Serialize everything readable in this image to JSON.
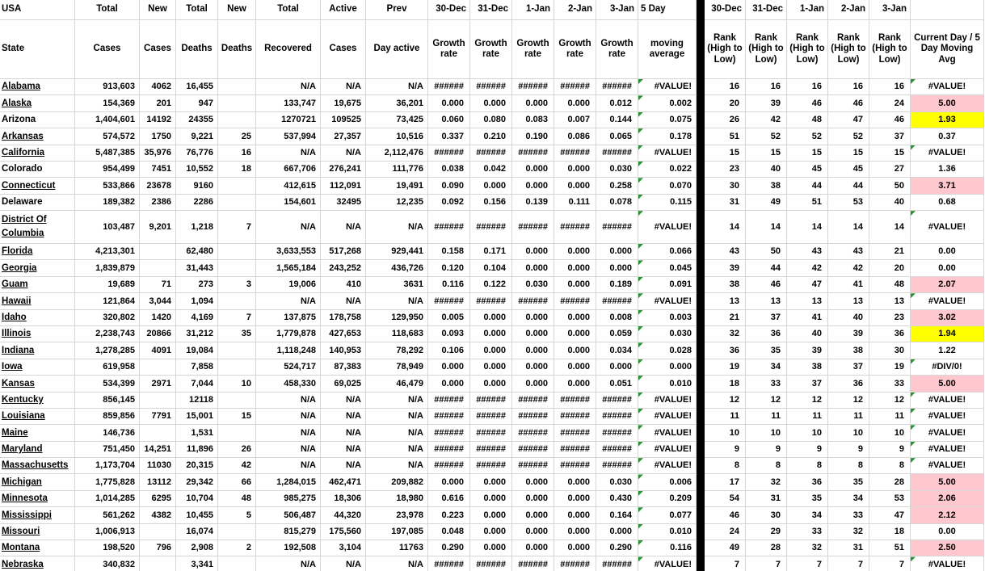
{
  "colors": {
    "gridline": "#d6d6d6",
    "highlight_pink": "#ffc7ce",
    "highlight_yellow": "#ffff00",
    "error_flag_green": "#2a9134",
    "divider_black": "#000000"
  },
  "header": {
    "row1": [
      "USA",
      "Total",
      "New",
      "Total",
      "New",
      "Total",
      "Active",
      "Prev",
      "30-Dec",
      "31-Dec",
      "1-Jan",
      "2-Jan",
      "3-Jan",
      "5 Day",
      "",
      "30-Dec",
      "31-Dec",
      "1-Jan",
      "2-Jan",
      "3-Jan",
      ""
    ],
    "row2": [
      "State",
      "Cases",
      "Cases",
      "Deaths",
      "Deaths",
      "Recovered",
      "Cases",
      "Day active",
      "Growth rate",
      "Growth rate",
      "Growth rate",
      "Growth rate",
      "Growth rate",
      "moving average",
      "",
      "Rank (High to Low)",
      "Rank (High to Low)",
      "Rank (High to Low)",
      "Rank (High to Low)",
      "Rank (High to Low)",
      "Current Day / 5 Day Moving Avg"
    ]
  },
  "rows": [
    {
      "state": "Alabama",
      "underline": true,
      "tall": false,
      "cases": "913,603",
      "new_cases": "4062",
      "deaths": "16,455",
      "new_deaths": "",
      "recovered": "N/A",
      "active": "N/A",
      "prev": "N/A",
      "g": [
        "######",
        "######",
        "######",
        "######",
        "######"
      ],
      "avg": "#VALUE!",
      "rank": [
        "16",
        "16",
        "16",
        "16",
        "16"
      ],
      "ratio": "#VALUE!",
      "ratio_bg": "none",
      "ratio_flag": true
    },
    {
      "state": "Alaska",
      "underline": true,
      "tall": false,
      "cases": "154,369",
      "new_cases": "201",
      "deaths": "947",
      "new_deaths": "",
      "recovered": "133,747",
      "active": "19,675",
      "prev": "36,201",
      "g": [
        "0.000",
        "0.000",
        "0.000",
        "0.000",
        "0.012"
      ],
      "avg": "0.002",
      "rank": [
        "20",
        "39",
        "46",
        "46",
        "24"
      ],
      "ratio": "5.00",
      "ratio_bg": "pink",
      "ratio_flag": false
    },
    {
      "state": "Arizona",
      "underline": false,
      "tall": false,
      "cases": "1,404,601",
      "new_cases": "14192",
      "deaths": "24355",
      "new_deaths": "",
      "recovered": "1270721",
      "active": "109525",
      "prev": "73,425",
      "g": [
        "0.060",
        "0.080",
        "0.083",
        "0.007",
        "0.144"
      ],
      "avg": "0.075",
      "rank": [
        "26",
        "42",
        "48",
        "47",
        "46"
      ],
      "ratio": "1.93",
      "ratio_bg": "yellow",
      "ratio_flag": false
    },
    {
      "state": "Arkansas",
      "underline": true,
      "tall": false,
      "cases": "574,572",
      "new_cases": "1750",
      "deaths": "9,221",
      "new_deaths": "25",
      "recovered": "537,994",
      "active": "27,357",
      "prev": "10,516",
      "g": [
        "0.337",
        "0.210",
        "0.190",
        "0.086",
        "0.065"
      ],
      "avg": "0.178",
      "rank": [
        "51",
        "52",
        "52",
        "52",
        "37"
      ],
      "ratio": "0.37",
      "ratio_bg": "none",
      "ratio_flag": false
    },
    {
      "state": "California",
      "underline": true,
      "tall": false,
      "cases": "5,487,385",
      "new_cases": "35,976",
      "deaths": "76,776",
      "new_deaths": "16",
      "recovered": "N/A",
      "active": "N/A",
      "prev": "2,112,476",
      "g": [
        "######",
        "######",
        "######",
        "######",
        "######"
      ],
      "avg": "#VALUE!",
      "rank": [
        "15",
        "15",
        "15",
        "15",
        "15"
      ],
      "ratio": "#VALUE!",
      "ratio_bg": "none",
      "ratio_flag": true
    },
    {
      "state": "Colorado",
      "underline": false,
      "tall": false,
      "cases": "954,499",
      "new_cases": "7451",
      "deaths": "10,552",
      "new_deaths": "18",
      "recovered": "667,706",
      "active": "276,241",
      "prev": "111,776",
      "g": [
        "0.038",
        "0.042",
        "0.000",
        "0.000",
        "0.030"
      ],
      "avg": "0.022",
      "rank": [
        "23",
        "40",
        "45",
        "45",
        "27"
      ],
      "ratio": "1.36",
      "ratio_bg": "none",
      "ratio_flag": false
    },
    {
      "state": "Connecticut",
      "underline": true,
      "tall": false,
      "cases": "533,866",
      "new_cases": "23678",
      "deaths": "9160",
      "new_deaths": "",
      "recovered": "412,615",
      "active": "112,091",
      "prev": "19,491",
      "g": [
        "0.090",
        "0.000",
        "0.000",
        "0.000",
        "0.258"
      ],
      "avg": "0.070",
      "rank": [
        "30",
        "38",
        "44",
        "44",
        "50"
      ],
      "ratio": "3.71",
      "ratio_bg": "pink",
      "ratio_flag": false
    },
    {
      "state": "Delaware",
      "underline": false,
      "tall": false,
      "cases": "189,382",
      "new_cases": "2386",
      "deaths": "2286",
      "new_deaths": "",
      "recovered": "154,601",
      "active": "32495",
      "prev": "12,235",
      "g": [
        "0.092",
        "0.156",
        "0.139",
        "0.111",
        "0.078"
      ],
      "avg": "0.115",
      "rank": [
        "31",
        "49",
        "51",
        "53",
        "40"
      ],
      "ratio": "0.68",
      "ratio_bg": "none",
      "ratio_flag": false
    },
    {
      "state": "District Of Columbia",
      "underline": true,
      "tall": true,
      "cases": "103,487",
      "new_cases": "9,201",
      "deaths": "1,218",
      "new_deaths": "7",
      "recovered": "N/A",
      "active": "N/A",
      "prev": "N/A",
      "g": [
        "######",
        "######",
        "######",
        "######",
        "######"
      ],
      "avg": "#VALUE!",
      "rank": [
        "14",
        "14",
        "14",
        "14",
        "14"
      ],
      "ratio": "#VALUE!",
      "ratio_bg": "none",
      "ratio_flag": true
    },
    {
      "state": "Florida",
      "underline": true,
      "tall": false,
      "cases": "4,213,301",
      "new_cases": "",
      "deaths": "62,480",
      "new_deaths": "",
      "recovered": "3,633,553",
      "active": "517,268",
      "prev": "929,441",
      "g": [
        "0.158",
        "0.171",
        "0.000",
        "0.000",
        "0.000"
      ],
      "avg": "0.066",
      "rank": [
        "43",
        "50",
        "43",
        "43",
        "21"
      ],
      "ratio": "0.00",
      "ratio_bg": "none",
      "ratio_flag": false
    },
    {
      "state": "Georgia",
      "underline": true,
      "tall": false,
      "cases": "1,839,879",
      "new_cases": "",
      "deaths": "31,443",
      "new_deaths": "",
      "recovered": "1,565,184",
      "active": "243,252",
      "prev": "436,726",
      "g": [
        "0.120",
        "0.104",
        "0.000",
        "0.000",
        "0.000"
      ],
      "avg": "0.045",
      "rank": [
        "39",
        "44",
        "42",
        "42",
        "20"
      ],
      "ratio": "0.00",
      "ratio_bg": "none",
      "ratio_flag": false
    },
    {
      "state": "Guam",
      "underline": true,
      "tall": false,
      "cases": "19,689",
      "new_cases": "71",
      "deaths": "273",
      "new_deaths": "3",
      "recovered": "19,006",
      "active": "410",
      "prev": "3631",
      "g": [
        "0.116",
        "0.122",
        "0.030",
        "0.000",
        "0.189"
      ],
      "avg": "0.091",
      "rank": [
        "38",
        "46",
        "47",
        "41",
        "48"
      ],
      "ratio": "2.07",
      "ratio_bg": "pink",
      "ratio_flag": false
    },
    {
      "state": "Hawaii",
      "underline": true,
      "tall": false,
      "cases": "121,864",
      "new_cases": "3,044",
      "deaths": "1,094",
      "new_deaths": "",
      "recovered": "N/A",
      "active": "N/A",
      "prev": "N/A",
      "g": [
        "######",
        "######",
        "######",
        "######",
        "######"
      ],
      "avg": "#VALUE!",
      "rank": [
        "13",
        "13",
        "13",
        "13",
        "13"
      ],
      "ratio": "#VALUE!",
      "ratio_bg": "none",
      "ratio_flag": true
    },
    {
      "state": "Idaho",
      "underline": true,
      "tall": false,
      "cases": "320,802",
      "new_cases": "1420",
      "deaths": "4,169",
      "new_deaths": "7",
      "recovered": "137,875",
      "active": "178,758",
      "prev": "129,950",
      "g": [
        "0.005",
        "0.000",
        "0.000",
        "0.000",
        "0.008"
      ],
      "avg": "0.003",
      "rank": [
        "21",
        "37",
        "41",
        "40",
        "23"
      ],
      "ratio": "3.02",
      "ratio_bg": "pink",
      "ratio_flag": false
    },
    {
      "state": "Illinois",
      "underline": true,
      "tall": false,
      "cases": "2,238,743",
      "new_cases": "20866",
      "deaths": "31,212",
      "new_deaths": "35",
      "recovered": "1,779,878",
      "active": "427,653",
      "prev": "118,683",
      "g": [
        "0.093",
        "0.000",
        "0.000",
        "0.000",
        "0.059"
      ],
      "avg": "0.030",
      "rank": [
        "32",
        "36",
        "40",
        "39",
        "36"
      ],
      "ratio": "1.94",
      "ratio_bg": "yellow",
      "ratio_flag": false
    },
    {
      "state": "Indiana",
      "underline": true,
      "tall": false,
      "cases": "1,278,285",
      "new_cases": "4091",
      "deaths": "19,084",
      "new_deaths": "",
      "recovered": "1,118,248",
      "active": "140,953",
      "prev": "78,292",
      "g": [
        "0.106",
        "0.000",
        "0.000",
        "0.000",
        "0.034"
      ],
      "avg": "0.028",
      "rank": [
        "36",
        "35",
        "39",
        "38",
        "30"
      ],
      "ratio": "1.22",
      "ratio_bg": "none",
      "ratio_flag": false
    },
    {
      "state": "Iowa",
      "underline": true,
      "tall": false,
      "cases": "619,958",
      "new_cases": "",
      "deaths": "7,858",
      "new_deaths": "",
      "recovered": "524,717",
      "active": "87,383",
      "prev": "78,949",
      "g": [
        "0.000",
        "0.000",
        "0.000",
        "0.000",
        "0.000"
      ],
      "avg": "0.000",
      "rank": [
        "19",
        "34",
        "38",
        "37",
        "19"
      ],
      "ratio": "#DIV/0!",
      "ratio_bg": "none",
      "ratio_flag": true
    },
    {
      "state": "Kansas",
      "underline": true,
      "tall": false,
      "cases": "534,399",
      "new_cases": "2971",
      "deaths": "7,044",
      "new_deaths": "10",
      "recovered": "458,330",
      "active": "69,025",
      "prev": "46,479",
      "g": [
        "0.000",
        "0.000",
        "0.000",
        "0.000",
        "0.051"
      ],
      "avg": "0.010",
      "rank": [
        "18",
        "33",
        "37",
        "36",
        "33"
      ],
      "ratio": "5.00",
      "ratio_bg": "pink",
      "ratio_flag": false
    },
    {
      "state": "Kentucky",
      "underline": true,
      "tall": false,
      "cases": "856,145",
      "new_cases": "",
      "deaths": "12118",
      "new_deaths": "",
      "recovered": "N/A",
      "active": "N/A",
      "prev": "N/A",
      "g": [
        "######",
        "######",
        "######",
        "######",
        "######"
      ],
      "avg": "#VALUE!",
      "rank": [
        "12",
        "12",
        "12",
        "12",
        "12"
      ],
      "ratio": "#VALUE!",
      "ratio_bg": "none",
      "ratio_flag": true
    },
    {
      "state": "Louisiana",
      "underline": true,
      "tall": false,
      "cases": "859,856",
      "new_cases": "7791",
      "deaths": "15,001",
      "new_deaths": "15",
      "recovered": "N/A",
      "active": "N/A",
      "prev": "N/A",
      "g": [
        "######",
        "######",
        "######",
        "######",
        "######"
      ],
      "avg": "#VALUE!",
      "rank": [
        "11",
        "11",
        "11",
        "11",
        "11"
      ],
      "ratio": "#VALUE!",
      "ratio_bg": "none",
      "ratio_flag": true
    },
    {
      "state": "Maine",
      "underline": true,
      "tall": false,
      "cases": "146,736",
      "new_cases": "",
      "deaths": "1,531",
      "new_deaths": "",
      "recovered": "N/A",
      "active": "N/A",
      "prev": "N/A",
      "g": [
        "######",
        "######",
        "######",
        "######",
        "######"
      ],
      "avg": "#VALUE!",
      "rank": [
        "10",
        "10",
        "10",
        "10",
        "10"
      ],
      "ratio": "#VALUE!",
      "ratio_bg": "none",
      "ratio_flag": true
    },
    {
      "state": "Maryland",
      "underline": true,
      "tall": false,
      "cases": "751,450",
      "new_cases": "14,251",
      "deaths": "11,896",
      "new_deaths": "26",
      "recovered": "N/A",
      "active": "N/A",
      "prev": "N/A",
      "g": [
        "######",
        "######",
        "######",
        "######",
        "######"
      ],
      "avg": "#VALUE!",
      "rank": [
        "9",
        "9",
        "9",
        "9",
        "9"
      ],
      "ratio": "#VALUE!",
      "ratio_bg": "none",
      "ratio_flag": true
    },
    {
      "state": "Massachusetts",
      "underline": true,
      "tall": false,
      "cases": "1,173,704",
      "new_cases": "11030",
      "deaths": "20,315",
      "new_deaths": "42",
      "recovered": "N/A",
      "active": "N/A",
      "prev": "N/A",
      "g": [
        "######",
        "######",
        "######",
        "######",
        "######"
      ],
      "avg": "#VALUE!",
      "rank": [
        "8",
        "8",
        "8",
        "8",
        "8"
      ],
      "ratio": "#VALUE!",
      "ratio_bg": "none",
      "ratio_flag": true
    },
    {
      "state": "Michigan",
      "underline": true,
      "tall": false,
      "cases": "1,775,828",
      "new_cases": "13112",
      "deaths": "29,342",
      "new_deaths": "66",
      "recovered": "1,284,015",
      "active": "462,471",
      "prev": "209,882",
      "g": [
        "0.000",
        "0.000",
        "0.000",
        "0.000",
        "0.030"
      ],
      "avg": "0.006",
      "rank": [
        "17",
        "32",
        "36",
        "35",
        "28"
      ],
      "ratio": "5.00",
      "ratio_bg": "pink",
      "ratio_flag": false
    },
    {
      "state": "Minnesota",
      "underline": true,
      "tall": false,
      "cases": "1,014,285",
      "new_cases": "6295",
      "deaths": "10,704",
      "new_deaths": "48",
      "recovered": "985,275",
      "active": "18,306",
      "prev": "18,980",
      "g": [
        "0.616",
        "0.000",
        "0.000",
        "0.000",
        "0.430"
      ],
      "avg": "0.209",
      "rank": [
        "54",
        "31",
        "35",
        "34",
        "53"
      ],
      "ratio": "2.06",
      "ratio_bg": "pink",
      "ratio_flag": false
    },
    {
      "state": "Mississippi",
      "underline": true,
      "tall": false,
      "cases": "561,262",
      "new_cases": "4382",
      "deaths": "10,455",
      "new_deaths": "5",
      "recovered": "506,487",
      "active": "44,320",
      "prev": "23,978",
      "g": [
        "0.223",
        "0.000",
        "0.000",
        "0.000",
        "0.164"
      ],
      "avg": "0.077",
      "rank": [
        "46",
        "30",
        "34",
        "33",
        "47"
      ],
      "ratio": "2.12",
      "ratio_bg": "pink",
      "ratio_flag": false
    },
    {
      "state": "Missouri",
      "underline": true,
      "tall": false,
      "cases": "1,006,913",
      "new_cases": "",
      "deaths": "16,074",
      "new_deaths": "",
      "recovered": "815,279",
      "active": "175,560",
      "prev": "197,085",
      "g": [
        "0.048",
        "0.000",
        "0.000",
        "0.000",
        "0.000"
      ],
      "avg": "0.010",
      "rank": [
        "24",
        "29",
        "33",
        "32",
        "18"
      ],
      "ratio": "0.00",
      "ratio_bg": "none",
      "ratio_flag": false
    },
    {
      "state": "Montana",
      "underline": true,
      "tall": false,
      "cases": "198,520",
      "new_cases": "796",
      "deaths": "2,908",
      "new_deaths": "2",
      "recovered": "192,508",
      "active": "3,104",
      "prev": "11763",
      "g": [
        "0.290",
        "0.000",
        "0.000",
        "0.000",
        "0.290"
      ],
      "avg": "0.116",
      "rank": [
        "49",
        "28",
        "32",
        "31",
        "51"
      ],
      "ratio": "2.50",
      "ratio_bg": "pink",
      "ratio_flag": false
    },
    {
      "state": "Nebraska",
      "underline": true,
      "tall": false,
      "cases": "340,832",
      "new_cases": "",
      "deaths": "3,341",
      "new_deaths": "",
      "recovered": "N/A",
      "active": "N/A",
      "prev": "N/A",
      "g": [
        "######",
        "######",
        "######",
        "######",
        "######"
      ],
      "avg": "#VALUE!",
      "rank": [
        "7",
        "7",
        "7",
        "7",
        "7"
      ],
      "ratio": "#VALUE!",
      "ratio_bg": "none",
      "ratio_flag": true
    }
  ]
}
